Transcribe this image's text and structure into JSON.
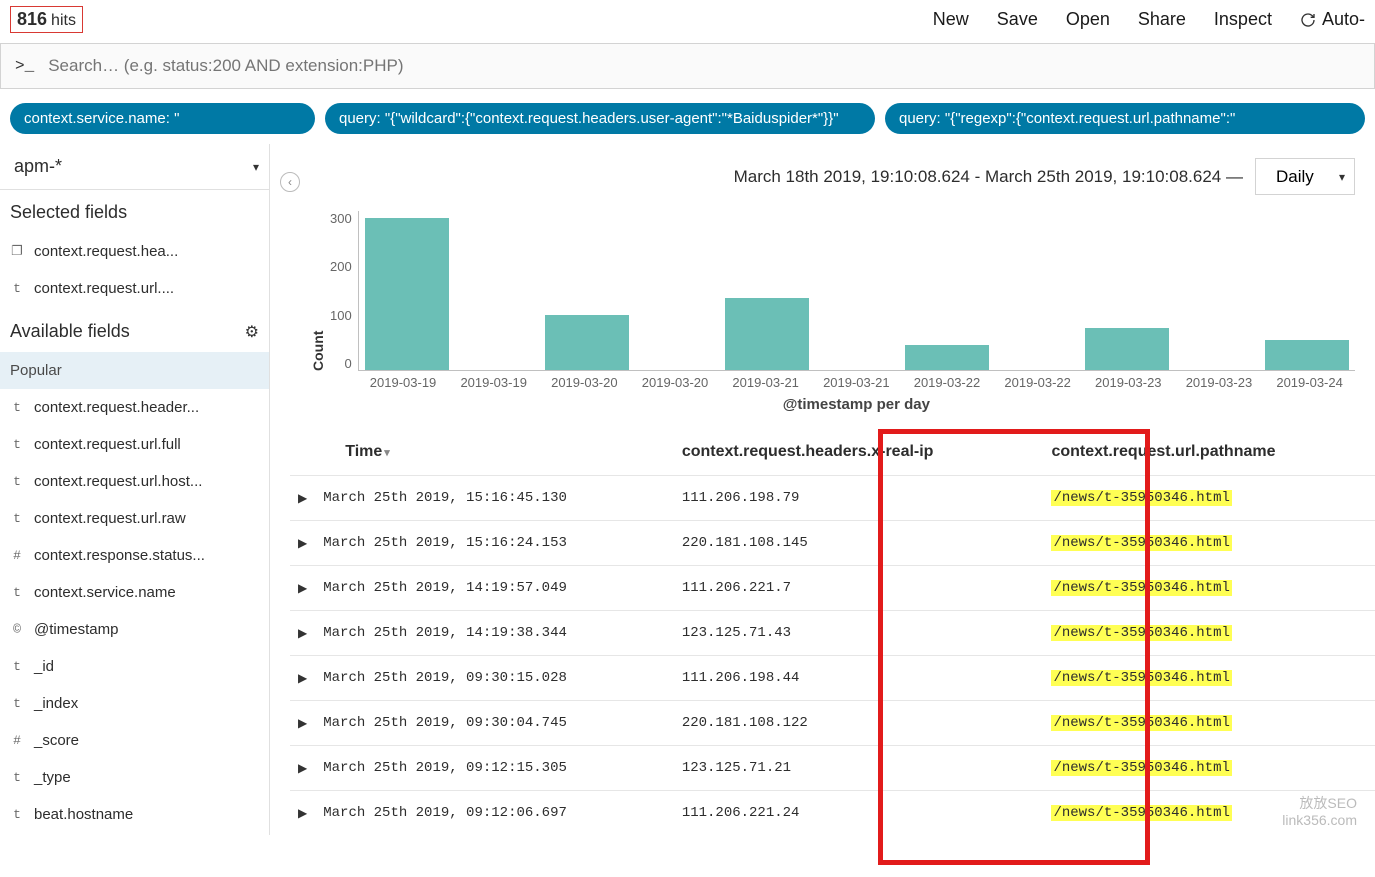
{
  "hits": {
    "count": "816",
    "label": "hits"
  },
  "menu": {
    "new": "New",
    "save": "Save",
    "open": "Open",
    "share": "Share",
    "inspect": "Inspect",
    "auto": "Auto-"
  },
  "search": {
    "placeholder": "Search… (e.g. status:200 AND extension:PHP)"
  },
  "filters": [
    "context.service.name: \"",
    "query: \"{\"wildcard\":{\"context.request.headers.user-agent\":\"*Baiduspider*\"}}\"",
    "query: \"{\"regexp\":{\"context.request.url.pathname\":\""
  ],
  "index_pattern": "apm-*",
  "sidebar": {
    "selected_title": "Selected fields",
    "selected": [
      {
        "type": "laptop",
        "name": "context.request.hea..."
      },
      {
        "type": "t",
        "name": "context.request.url...."
      }
    ],
    "available_title": "Available fields",
    "popular_label": "Popular",
    "available": [
      {
        "type": "t",
        "name": "context.request.header..."
      },
      {
        "type": "t",
        "name": "context.request.url.full"
      },
      {
        "type": "t",
        "name": "context.request.url.host..."
      },
      {
        "type": "t",
        "name": "context.request.url.raw"
      },
      {
        "type": "#",
        "name": "context.response.status..."
      },
      {
        "type": "t",
        "name": "context.service.name"
      },
      {
        "type": "©",
        "name": "@timestamp"
      },
      {
        "type": "t",
        "name": "_id"
      },
      {
        "type": "t",
        "name": "_index"
      },
      {
        "type": "#",
        "name": "_score"
      },
      {
        "type": "t",
        "name": "_type"
      },
      {
        "type": "t",
        "name": "beat.hostname"
      }
    ]
  },
  "date_range": "March 18th 2019, 19:10:08.624 - March 25th 2019, 19:10:08.624 —",
  "interval": "Daily",
  "chart_data": {
    "type": "bar",
    "title": "",
    "xlabel": "@timestamp per day",
    "ylabel": "Count",
    "ylim": [
      0,
      320
    ],
    "yticks": [
      300,
      200,
      100,
      0
    ],
    "categories": [
      "2019-03-19",
      "2019-03-19",
      "2019-03-20",
      "2019-03-20",
      "2019-03-21",
      "2019-03-21",
      "2019-03-22",
      "2019-03-22",
      "2019-03-23",
      "2019-03-23",
      "2019-03-24"
    ],
    "values": [
      305,
      0,
      110,
      0,
      145,
      0,
      50,
      0,
      85,
      0,
      60
    ]
  },
  "table": {
    "cols": {
      "time": "Time",
      "ip": "context.request.headers.x-real-ip",
      "path": "context.request.url.pathname"
    },
    "rows": [
      {
        "time": "March 25th 2019, 15:16:45.130",
        "ip": "111.206.198.79",
        "path": "/news/t-35950346.html"
      },
      {
        "time": "March 25th 2019, 15:16:24.153",
        "ip": "220.181.108.145",
        "path": "/news/t-35950346.html"
      },
      {
        "time": "March 25th 2019, 14:19:57.049",
        "ip": "111.206.221.7",
        "path": "/news/t-35950346.html"
      },
      {
        "time": "March 25th 2019, 14:19:38.344",
        "ip": "123.125.71.43",
        "path": "/news/t-35950346.html"
      },
      {
        "time": "March 25th 2019, 09:30:15.028",
        "ip": "111.206.198.44",
        "path": "/news/t-35950346.html"
      },
      {
        "time": "March 25th 2019, 09:30:04.745",
        "ip": "220.181.108.122",
        "path": "/news/t-35950346.html"
      },
      {
        "time": "March 25th 2019, 09:12:15.305",
        "ip": "123.125.71.21",
        "path": "/news/t-35950346.html"
      },
      {
        "time": "March 25th 2019, 09:12:06.697",
        "ip": "111.206.221.24",
        "path": "/news/t-35950346.html"
      }
    ]
  },
  "watermark": {
    "l1": "放放SEO",
    "l2": "link356.com"
  }
}
